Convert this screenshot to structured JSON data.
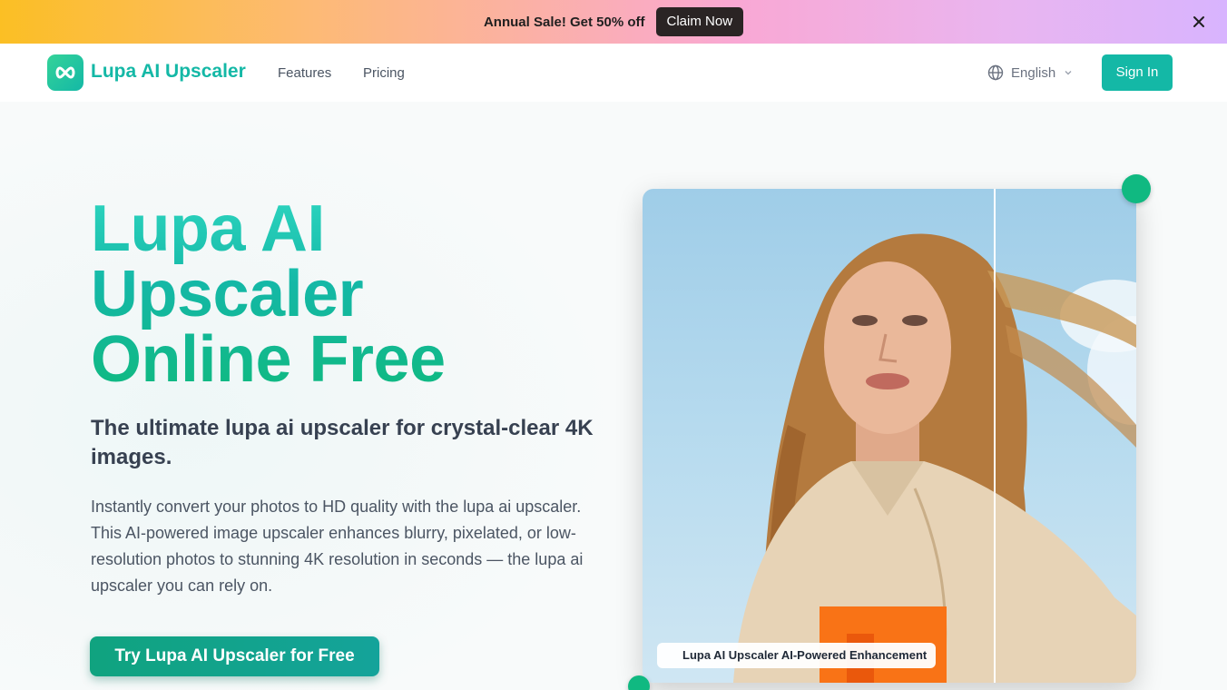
{
  "promo": {
    "text": "Annual Sale! Get 50% off",
    "button_label": "Claim Now",
    "close_icon": "close-icon"
  },
  "nav": {
    "brand": "Lupa AI Upscaler",
    "logo_icon": "infinity-icon",
    "links": [
      "Features",
      "Pricing"
    ],
    "language": "English",
    "language_icon": "globe-icon",
    "sign_in": "Sign In"
  },
  "hero": {
    "title_lines": [
      "Lupa AI",
      "Upscaler",
      "Online Free"
    ],
    "subtitle": "The ultimate lupa ai upscaler for crystal-clear 4K images.",
    "description": "Instantly convert your photos to HD quality with the lupa ai upscaler. This AI-powered image upscaler enhances blurry, pixelated, or low-resolution photos to stunning 4K resolution in seconds — the lupa ai upscaler you can rely on.",
    "cta_label": "Try Lupa AI Upscaler for Free"
  },
  "comparison": {
    "badge": "Lupa AI Upscaler AI-Powered Enhancement"
  },
  "colors": {
    "brand": "#14b8a6",
    "cta": "#10a37f",
    "dot": "#10b981"
  }
}
